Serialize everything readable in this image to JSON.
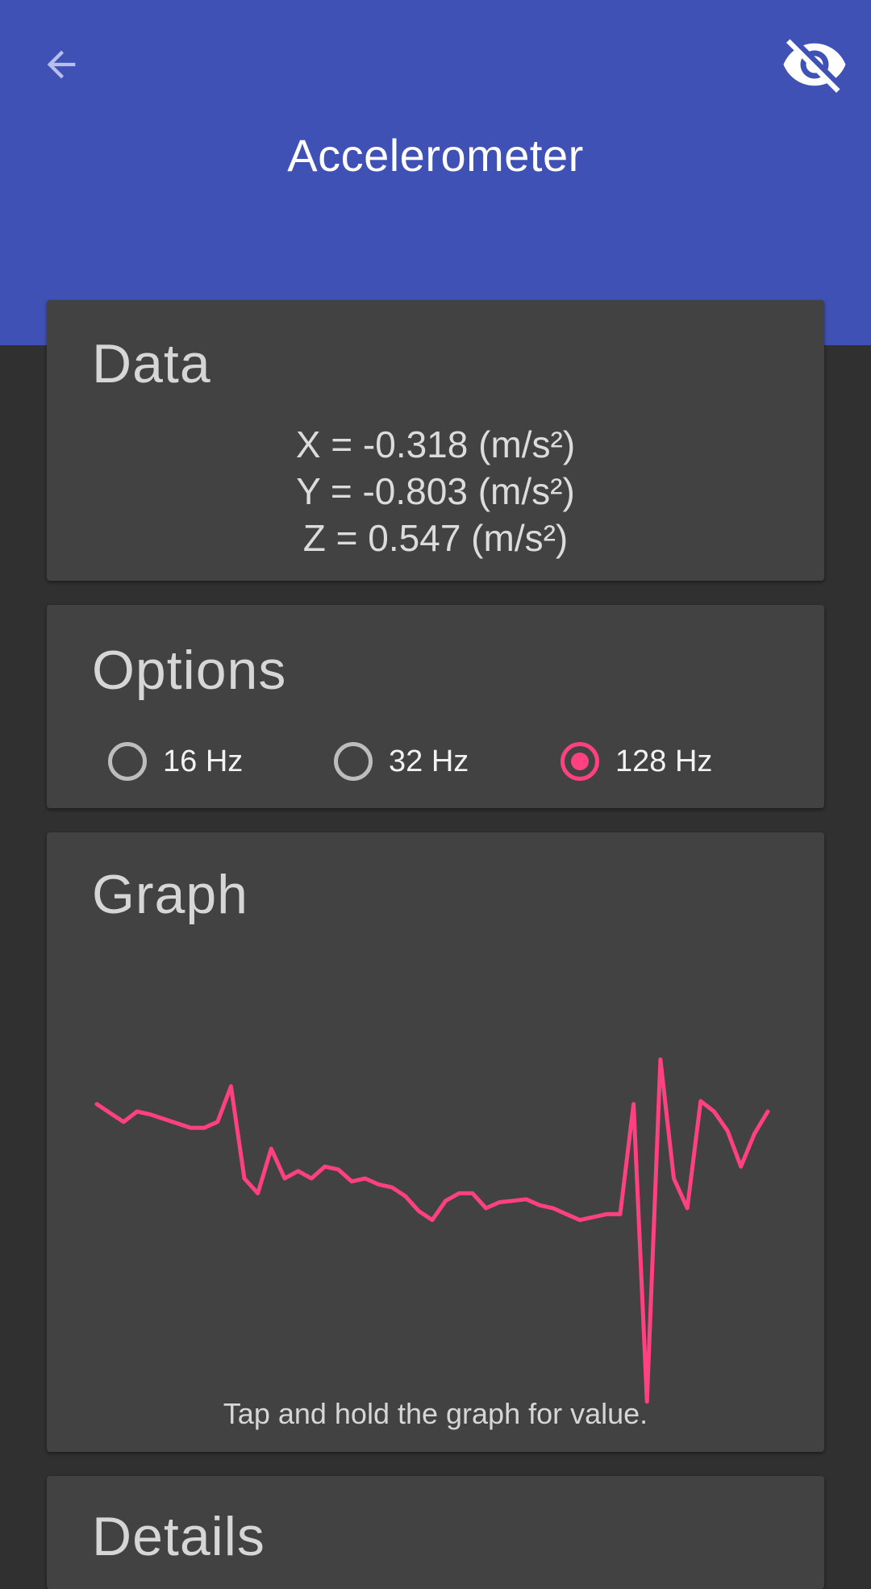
{
  "app_bar": {
    "title": "Accelerometer",
    "back_icon": "arrow-back-icon",
    "visibility_icon": "visibility-off-icon",
    "color": "#3F51B5"
  },
  "data_card": {
    "title": "Data",
    "lines": [
      "X = -0.318 (m/s²)",
      "Y = -0.803 (m/s²)",
      "Z = 0.547 (m/s²)"
    ]
  },
  "options_card": {
    "title": "Options",
    "options": [
      {
        "label": "16 Hz",
        "checked": false
      },
      {
        "label": "32 Hz",
        "checked": false
      },
      {
        "label": "128 Hz",
        "checked": true
      }
    ],
    "accent": "#FF4081"
  },
  "graph_card": {
    "title": "Graph",
    "hint": "Tap and hold the graph for value.",
    "line_color": "#FF4081"
  },
  "details_card": {
    "title": "Details"
  },
  "chart_data": {
    "type": "line",
    "title": "",
    "xlabel": "",
    "ylabel": "",
    "grid": false,
    "ylim": [
      -1.6,
      1.6
    ],
    "series": [
      {
        "values": [
          0.5,
          0.44,
          0.38,
          0.45,
          0.43,
          0.4,
          0.37,
          0.34,
          0.34,
          0.38,
          0.62,
          0.0,
          -0.1,
          0.2,
          0.0,
          0.05,
          0.0,
          0.08,
          0.06,
          -0.02,
          0.0,
          -0.04,
          -0.06,
          -0.12,
          -0.22,
          -0.28,
          -0.15,
          -0.1,
          -0.1,
          -0.2,
          -0.16,
          -0.15,
          -0.14,
          -0.18,
          -0.2,
          -0.24,
          -0.28,
          -0.26,
          -0.24,
          -0.24,
          0.5,
          -1.5,
          0.8,
          0.0,
          -0.2,
          0.52,
          0.45,
          0.32,
          0.08,
          0.3,
          0.45
        ]
      }
    ]
  }
}
